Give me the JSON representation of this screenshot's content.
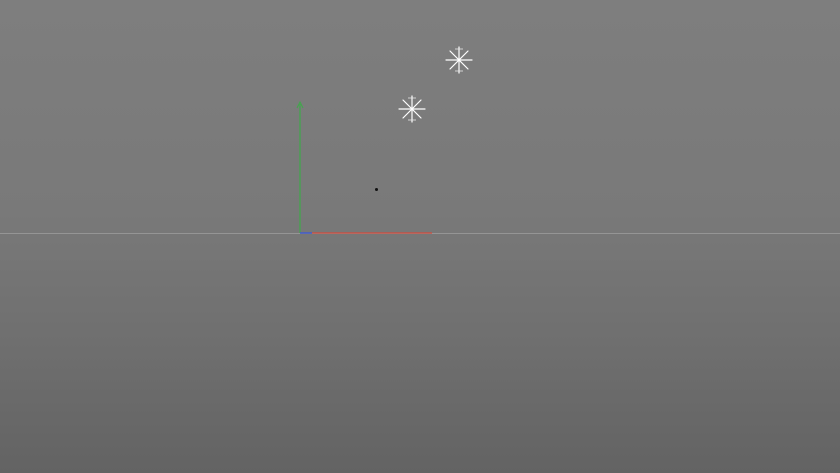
{
  "viewport": {
    "background_top": "#7e7e7e",
    "background_bottom": "#636363",
    "horizon_color": "#9a9a9a"
  },
  "axes": {
    "x_color": "#d24a3c",
    "y_color": "#3fa94a",
    "z_color": "#3a5fd0"
  },
  "lights": [
    {
      "icon": "point-light-icon"
    },
    {
      "icon": "point-light-icon"
    }
  ],
  "selected_object": {
    "icon": "object-point-icon"
  }
}
